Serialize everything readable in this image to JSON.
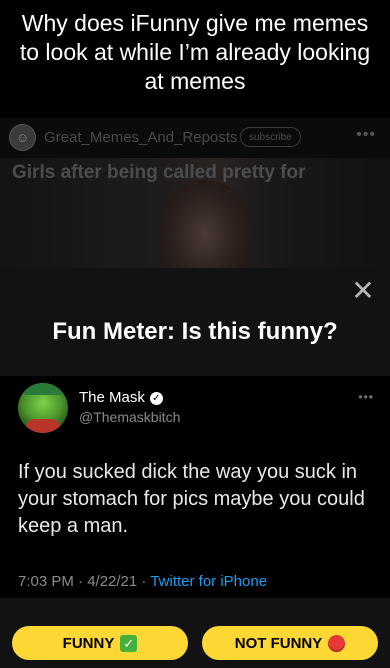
{
  "top_caption": "Why does iFunny give me memes to look at while I’m already looking at memes",
  "post": {
    "channel_name": "Great_Memes_And_Reposts",
    "subscribe_label": "subscribe",
    "more_label": "•••",
    "preview_text": "Girls after being called pretty for"
  },
  "modal": {
    "close_label": "✕",
    "title": "Fun Meter: Is this funny?",
    "tweet": {
      "display_name": "The Mask",
      "verified_label": "✓",
      "handle": "@Themaskbitch",
      "more_label": "•••",
      "text": "If you sucked dick the way you suck in your stomach for pics maybe you could keep a man.",
      "time": "7:03 PM · 4/22/21 · ",
      "client": "Twitter for iPhone"
    },
    "buttons": {
      "funny_label": "FUNNY",
      "funny_icon": "✅",
      "not_funny_label": "NOT FUNNY",
      "not_funny_icon": "red-circle"
    }
  },
  "colors": {
    "button_yellow": "#fdd835",
    "link_blue": "#1d9bf0",
    "modal_bg": "#121212"
  }
}
